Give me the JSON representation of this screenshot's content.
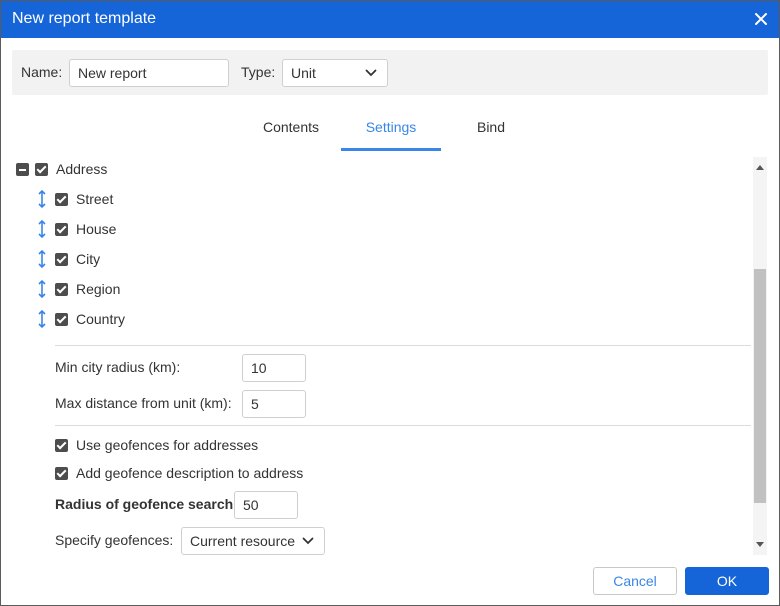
{
  "window": {
    "title": "New report template"
  },
  "header": {
    "name_label": "Name:",
    "name_value": "New report",
    "type_label": "Type:",
    "type_value": "Unit"
  },
  "tabs": [
    {
      "label": "Contents",
      "active": false
    },
    {
      "label": "Settings",
      "active": true
    },
    {
      "label": "Bind",
      "active": false
    }
  ],
  "address": {
    "label": "Address",
    "items": [
      {
        "label": "Street",
        "checked": true
      },
      {
        "label": "House",
        "checked": true
      },
      {
        "label": "City",
        "checked": true
      },
      {
        "label": "Region",
        "checked": true
      },
      {
        "label": "Country",
        "checked": true
      }
    ]
  },
  "settings": {
    "min_city_radius_label": "Min city radius (km):",
    "min_city_radius_value": "10",
    "max_distance_label": "Max distance from unit (km):",
    "max_distance_value": "5",
    "use_geofences_label": "Use geofences for addresses",
    "add_geofence_desc_label": "Add geofence description to address",
    "radius_geofence_label": "Radius of geofence search:",
    "radius_geofence_value": "50",
    "specify_geofences_label": "Specify geofences:",
    "specify_geofences_value": "Current resource"
  },
  "buttons": {
    "cancel": "Cancel",
    "ok": "OK"
  },
  "colors": {
    "titlebar": "#1565d8",
    "accent": "#3a86e8",
    "checkbox": "#4d4d4d"
  },
  "icons": [
    "close-icon",
    "chevron-down-icon",
    "drag-vertical-icon",
    "collapse-minus-icon",
    "checkbox-checked-icon"
  ]
}
